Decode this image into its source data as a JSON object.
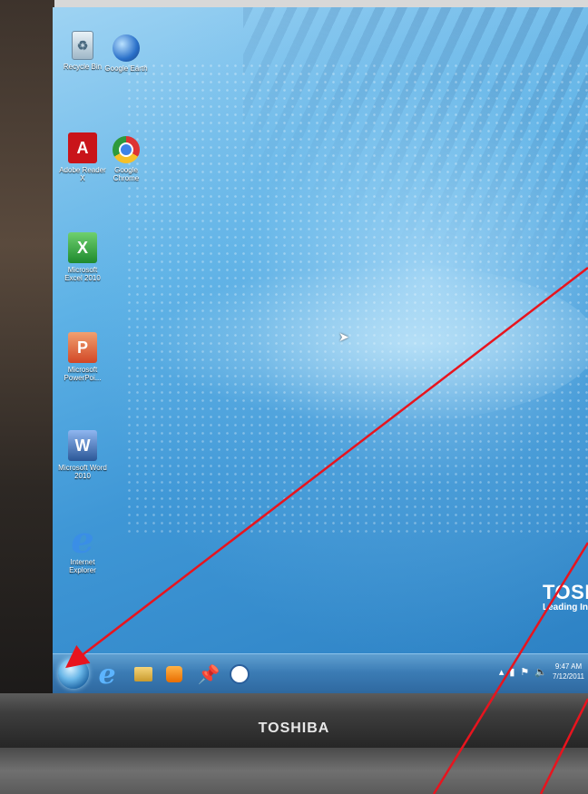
{
  "desktop": {
    "icons": [
      {
        "name": "recycle-bin-icon",
        "label": "Recycle Bin"
      },
      {
        "name": "google-earth-icon",
        "label": "Google Earth"
      },
      {
        "name": "adobe-reader-icon",
        "label": "Adobe Reader X"
      },
      {
        "name": "google-chrome-icon",
        "label": "Google Chrome"
      },
      {
        "name": "excel-icon",
        "label": "Microsoft Excel 2010"
      },
      {
        "name": "powerpoint-icon",
        "label": "Microsoft PowerPoi..."
      },
      {
        "name": "word-icon",
        "label": "Microsoft Word 2010"
      },
      {
        "name": "internet-explorer-icon",
        "label": "Internet Explorer"
      }
    ],
    "brand_name": "TOSI",
    "brand_tag": "Leading In"
  },
  "taskbar": {
    "clock_time": "9:47 AM",
    "clock_date": "7/12/2011"
  },
  "bezel": {
    "logo": "TOSHIBA"
  },
  "colors": {
    "annotation_arrow": "#e8141e",
    "taskbar": "#3b7cb5",
    "desktop": "#4a9fdc"
  }
}
